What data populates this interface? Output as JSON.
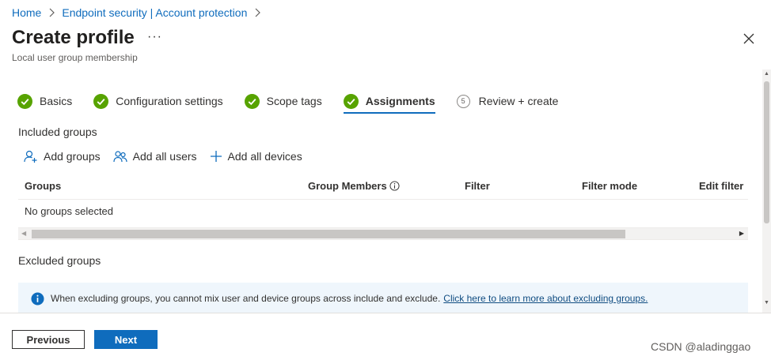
{
  "breadcrumb": [
    {
      "label": "Home"
    },
    {
      "label": "Endpoint security | Account protection"
    }
  ],
  "header": {
    "title": "Create profile",
    "more": "···",
    "subtitle": "Local user group membership"
  },
  "steps": [
    {
      "label": "Basics",
      "state": "done"
    },
    {
      "label": "Configuration settings",
      "state": "done"
    },
    {
      "label": "Scope tags",
      "state": "done"
    },
    {
      "label": "Assignments",
      "state": "active"
    },
    {
      "label": "Review + create",
      "state": "pending",
      "number": "5"
    }
  ],
  "included": {
    "label": "Included groups",
    "actions": {
      "add_groups": "Add groups",
      "add_all_users": "Add all users",
      "add_all_devices": "Add all devices"
    },
    "columns": {
      "groups": "Groups",
      "group_members": "Group Members",
      "filter": "Filter",
      "filter_mode": "Filter mode",
      "edit_filter": "Edit filter"
    },
    "empty_row": "No groups selected"
  },
  "excluded": {
    "label": "Excluded groups",
    "info_text": "When excluding groups, you cannot mix user and device groups across include and exclude.",
    "info_link": "Click here to learn more about excluding groups."
  },
  "footer": {
    "previous": "Previous",
    "next": "Next",
    "watermark": "CSDN @aladinggao"
  },
  "colors": {
    "accent": "#0f6cbd",
    "success": "#57a300",
    "info_bg": "#eff6fc"
  }
}
